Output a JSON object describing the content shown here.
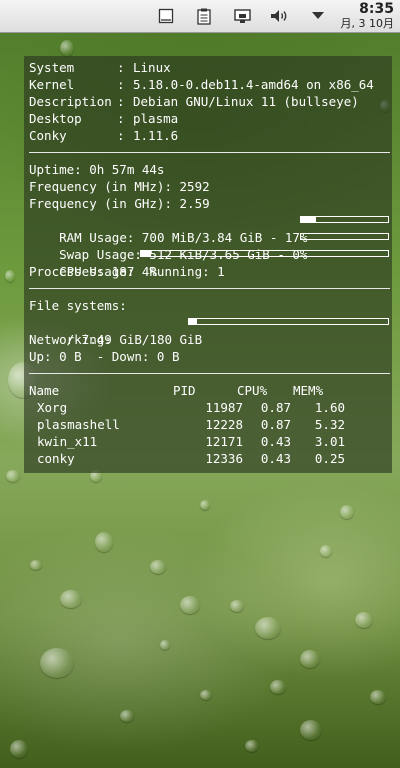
{
  "panel": {
    "clock_time": "8:35",
    "clock_date": "月, 3 10月",
    "tray_icons": [
      "window-icon",
      "clipboard-icon",
      "network-icon",
      "volume-icon",
      "dropdown-arrow-icon"
    ]
  },
  "conky": {
    "system": [
      {
        "label": "System",
        "value": "Linux"
      },
      {
        "label": "Kernel",
        "value": "5.18.0-0.deb11.4-amd64 on x86_64"
      },
      {
        "label": "Description",
        "value": "Debian GNU/Linux 11 (bullseye)"
      },
      {
        "label": "Desktop",
        "value": "plasma"
      },
      {
        "label": "Conky",
        "value": "1.11.6"
      }
    ],
    "separator": ":",
    "uptime": "Uptime: 0h 57m 44s",
    "freq_mhz": "Frequency (in MHz): 2592",
    "freq_ghz": "Frequency (in GHz): 2.59",
    "ram_text": "RAM Usage: 700 MiB/3.84 GiB - 17%",
    "ram_percent": 17,
    "swap_text": "Swap Usage: 512 KiB/3.65 GiB - 0%",
    "swap_percent": 0,
    "cpu_text": "CPU Usage: 4%",
    "cpu_percent": 4,
    "processes_text": "Processes: 187  Running: 1",
    "fs_title": "File systems:",
    "fs_text": " / 7.49 GiB/180 GiB",
    "fs_percent": 4,
    "net_title": "Networking:",
    "net_text": "Up: 0 B  - Down: 0 B",
    "proc_headers": {
      "name": "Name",
      "pid": "PID",
      "cpu": "CPU%",
      "mem": "MEM%"
    },
    "procs": [
      {
        "name": "Xorg",
        "pid": "11987",
        "cpu": "0.87",
        "mem": "1.60"
      },
      {
        "name": "plasmashell",
        "pid": "12228",
        "cpu": "0.87",
        "mem": "5.32"
      },
      {
        "name": "kwin_x11",
        "pid": "12171",
        "cpu": "0.43",
        "mem": "3.01"
      },
      {
        "name": "conky",
        "pid": "12336",
        "cpu": "0.43",
        "mem": "0.25"
      }
    ]
  }
}
